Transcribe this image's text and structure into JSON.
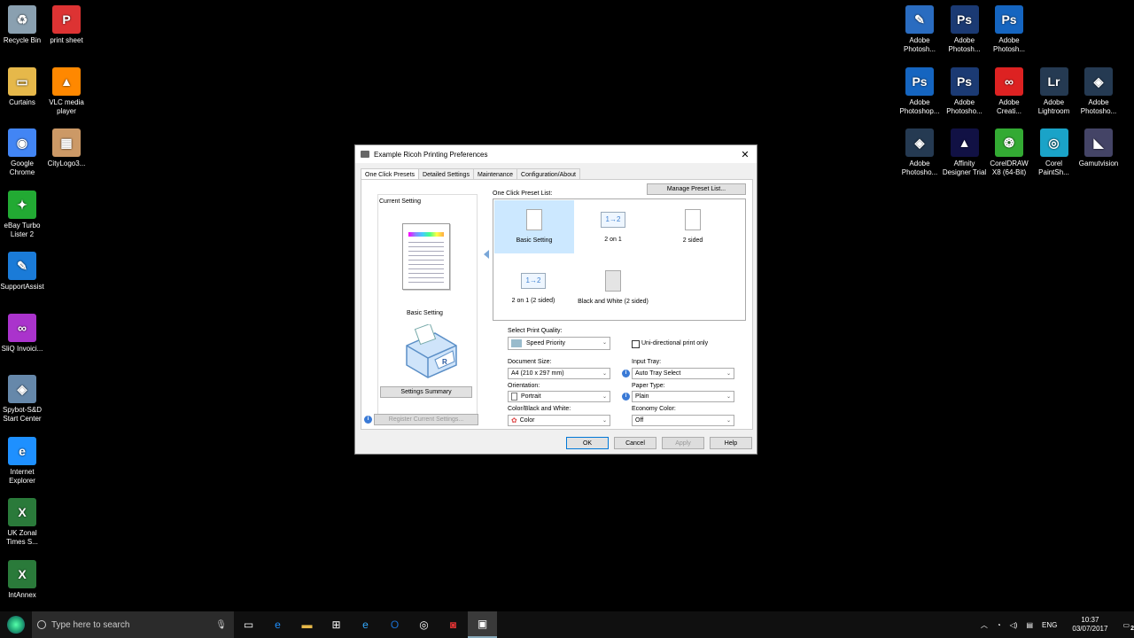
{
  "desktop_left": [
    {
      "label": "Recycle Bin",
      "icon": "recycle-bin-icon",
      "color": "#8aa0b0",
      "glyph": "♻"
    },
    {
      "label": "print sheet",
      "icon": "pdf-file-icon",
      "color": "#d33",
      "glyph": "P"
    },
    {
      "label": "Curtains",
      "icon": "folder-icon",
      "color": "#e6b84a",
      "glyph": "▭"
    },
    {
      "label": "VLC media player",
      "icon": "vlc-icon",
      "color": "#f80",
      "glyph": "▲"
    },
    {
      "label": "Google Chrome",
      "icon": "chrome-icon",
      "color": "#4285f4",
      "glyph": "◉"
    },
    {
      "label": "CityLogo3...",
      "icon": "image-file-icon",
      "color": "#c96",
      "glyph": "▦"
    },
    {
      "label": "eBay Turbo Lister 2",
      "icon": "ebay-icon",
      "color": "#2a3",
      "glyph": "✦"
    },
    {
      "label": "SupportAssist",
      "icon": "wrench-icon",
      "color": "#1a7bd8",
      "glyph": "✎"
    },
    {
      "label": "SliQ Invoici...",
      "icon": "sliq-icon",
      "color": "#a3c",
      "glyph": "∞"
    },
    {
      "label": "Spybot-S&D Start Center",
      "icon": "spybot-icon",
      "color": "#68a",
      "glyph": "◈"
    },
    {
      "label": "Internet Explorer",
      "icon": "ie-icon",
      "color": "#1e90ff",
      "glyph": "e"
    },
    {
      "label": "UK Zonal Times S...",
      "icon": "excel-file-icon",
      "color": "#2a7a3a",
      "glyph": "X"
    },
    {
      "label": "IntAnnex",
      "icon": "excel-file-icon",
      "color": "#2a7a3a",
      "glyph": "X"
    }
  ],
  "desktop_right": [
    {
      "label": "Adobe Photosh...",
      "icon": "photoshop-express-icon",
      "color": "#2a6cc0",
      "glyph": "✎"
    },
    {
      "label": "Adobe Photosh...",
      "icon": "photoshop-icon",
      "color": "#1b3a73",
      "glyph": "Ps"
    },
    {
      "label": "Adobe Photosh...",
      "icon": "photoshop-icon",
      "color": "#1565c0",
      "glyph": "Ps"
    },
    {
      "label": "Adobe Photoshop...",
      "icon": "photoshop-icon",
      "color": "#1565c0",
      "glyph": "Ps"
    },
    {
      "label": "Adobe Photosho...",
      "icon": "photoshop-icon",
      "color": "#1b3a73",
      "glyph": "Ps"
    },
    {
      "label": "Adobe Creati...",
      "icon": "creative-cloud-icon",
      "color": "#d22",
      "glyph": "∞"
    },
    {
      "label": "Adobe Lightroom",
      "icon": "lightroom-icon",
      "color": "#253a52",
      "glyph": "Lr"
    },
    {
      "label": "Adobe Photosho...",
      "icon": "photoshop-elements-icon",
      "color": "#253a52",
      "glyph": "◈"
    },
    {
      "label": "Adobe Photosho...",
      "icon": "photoshop-elements-icon",
      "color": "#253a52",
      "glyph": "◈"
    },
    {
      "label": "Affinity Designer Trial",
      "icon": "affinity-designer-icon",
      "color": "#114",
      "glyph": "▲"
    },
    {
      "label": "CorelDRAW X8 (64-Bit)",
      "icon": "coreldraw-icon",
      "color": "#3a3",
      "glyph": "❂"
    },
    {
      "label": "Corel PaintSh...",
      "icon": "paintshop-icon",
      "color": "#1aa3c8",
      "glyph": "◎"
    },
    {
      "label": "Gamutvision",
      "icon": "gamutvision-icon",
      "color": "#446",
      "glyph": "◣"
    }
  ],
  "dialog": {
    "title": "Example Ricoh Printing Preferences",
    "close_glyph": "✕",
    "tabs": [
      "One Click Presets",
      "Detailed Settings",
      "Maintenance",
      "Configuration/About"
    ],
    "current_setting_label": "Current Setting",
    "current_setting_name": "Basic Setting",
    "settings_summary_button": "Settings Summary",
    "register_button": "Register Current Settings...",
    "manage_button": "Manage Preset List...",
    "preset_list_label": "One Click Preset List:",
    "presets": [
      {
        "label": "Basic Setting",
        "selected": true
      },
      {
        "label": "2 on 1",
        "selected": false
      },
      {
        "label": "2 sided",
        "selected": false
      },
      {
        "label": "2 on 1 (2 sided)",
        "selected": false
      },
      {
        "label": "Black and White (2 sided)",
        "selected": false
      }
    ],
    "two_on_one_glyph": "1→2",
    "print_quality_label": "Select Print Quality:",
    "print_quality_value": "Speed Priority",
    "uni_directional_label": "Uni-directional print only",
    "uni_directional_checked": false,
    "document_size_label": "Document Size:",
    "document_size_value": "A4 (210 x 297 mm)",
    "input_tray_label": "Input Tray:",
    "input_tray_value": "Auto Tray Select",
    "orientation_label": "Orientation:",
    "orientation_value": "Portrait",
    "paper_type_label": "Paper Type:",
    "paper_type_value": "Plain",
    "color_bw_label": "Color/Black and White:",
    "color_bw_value": "Color",
    "economy_color_label": "Economy Color:",
    "economy_color_value": "Off",
    "ok_button": "OK",
    "cancel_button": "Cancel",
    "apply_button": "Apply",
    "help_button": "Help"
  },
  "taskbar": {
    "search_placeholder": "Type here to search",
    "language": "ENG",
    "time": "10:37",
    "date": "03/07/2017",
    "notification_count": "2"
  }
}
